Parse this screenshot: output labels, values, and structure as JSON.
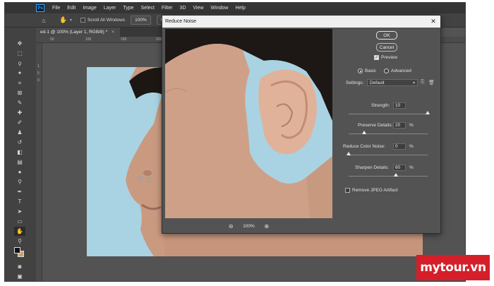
{
  "app": {
    "logo_text": "Ps",
    "menu": [
      "File",
      "Edit",
      "Image",
      "Layer",
      "Type",
      "Select",
      "Filter",
      "3D",
      "View",
      "Window",
      "Help"
    ],
    "options_bar": {
      "scroll_all_windows": "Scroll All Windows",
      "zoom_value": "100%",
      "fit_screen": "Fit Screen"
    },
    "document_tab": "ed-1 @ 100% (Layer 1, RGB/8) *",
    "document_tab_close": "×",
    "ruler_top": [
      "50",
      "100",
      "150",
      "200",
      "250",
      "300"
    ],
    "ruler_left": [
      "1",
      "5",
      "0"
    ]
  },
  "dialog": {
    "title": "Reduce Noise",
    "close_glyph": "✕",
    "ok": "OK",
    "cancel": "Cancel",
    "preview_label": "Preview",
    "preview_checked": true,
    "mode_basic": "Basic",
    "mode_advanced": "Advanced",
    "mode_selected": "Basic",
    "settings_label": "Settings:",
    "settings_value": "Default",
    "strength_label": "Strength:",
    "strength_value": "10",
    "strength_level": 1.0,
    "preserve_label": "Preserve Details:",
    "preserve_value": "20",
    "preserve_level": 0.2,
    "color_noise_label": "Reduce Color Noise:",
    "color_noise_value": "0",
    "color_noise_level": 0.0,
    "sharpen_label": "Sharpen Details:",
    "sharpen_value": "60",
    "sharpen_level": 0.6,
    "percent_sign": "%",
    "remove_jpeg_label": "Remove JPEG Artifact",
    "remove_jpeg_checked": false,
    "zoom_level": "100%",
    "zoom_out_glyph": "⊖",
    "zoom_in_glyph": "⊕"
  },
  "watermark": "mytour.vn",
  "icons": {
    "home": "home-icon",
    "hand": "hand-icon",
    "save_settings": "save-settings-icon",
    "delete_settings": "trash-icon"
  }
}
